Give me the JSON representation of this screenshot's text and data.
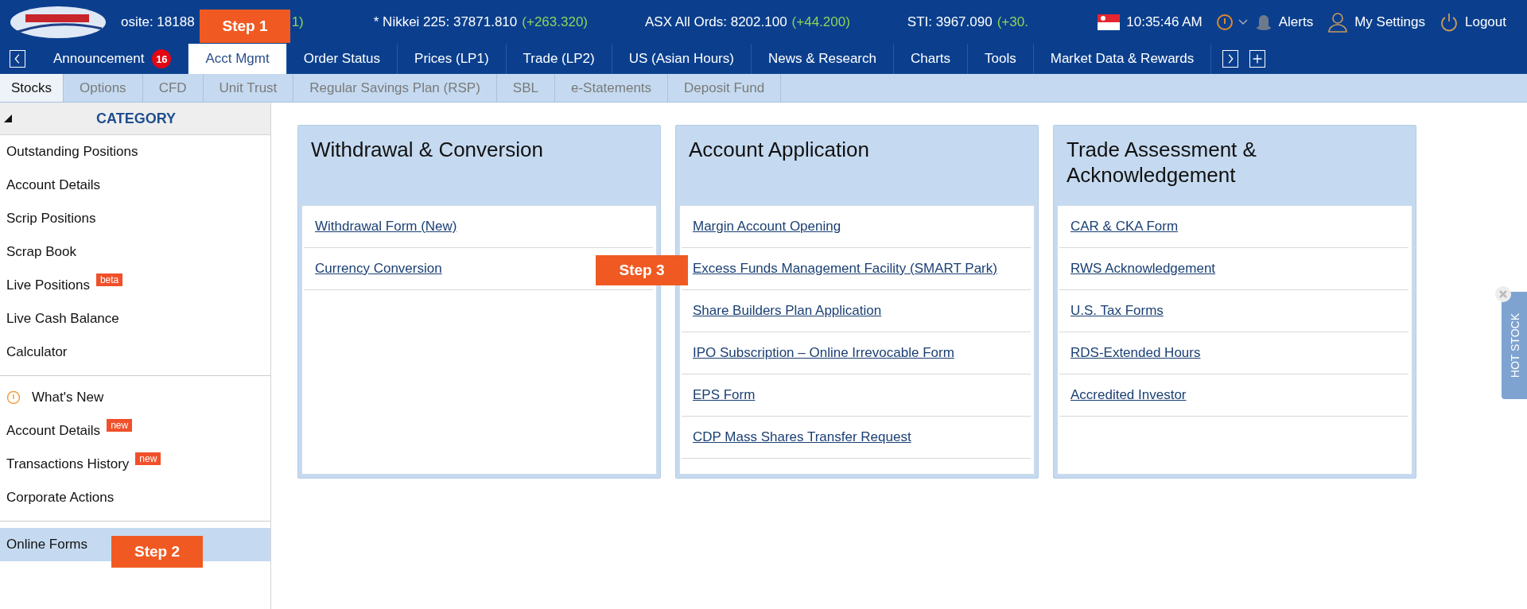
{
  "ticker": [
    {
      "text": "osite: 18188",
      "change": "1)"
    },
    {
      "text": "* Nikkei 225: 37871.810",
      "change": "(+263.320)"
    },
    {
      "text": "ASX All Ords: 8202.100",
      "change": "(+44.200)"
    },
    {
      "text": "STI: 3967.090",
      "change": "(+30."
    }
  ],
  "header": {
    "time": "10:35:46 AM",
    "alerts": "Alerts",
    "settings": "My Settings",
    "logout": "Logout"
  },
  "nav": [
    {
      "label": "Announcement",
      "badge": "16",
      "selected": false
    },
    {
      "label": "Acct Mgmt",
      "selected": true
    },
    {
      "label": "Order Status",
      "selected": false
    },
    {
      "label": "Prices (LP1)",
      "selected": false
    },
    {
      "label": "Trade (LP2)",
      "selected": false
    },
    {
      "label": "US (Asian Hours)",
      "selected": false
    },
    {
      "label": "News & Research",
      "selected": false
    },
    {
      "label": "Charts",
      "selected": false
    },
    {
      "label": "Tools",
      "selected": false
    },
    {
      "label": "Market Data & Rewards",
      "selected": false
    }
  ],
  "subtabs": [
    {
      "label": "Stocks",
      "selected": true
    },
    {
      "label": "Options",
      "selected": false
    },
    {
      "label": "CFD",
      "selected": false
    },
    {
      "label": "Unit Trust",
      "selected": false
    },
    {
      "label": "Regular Savings Plan (RSP)",
      "selected": false
    },
    {
      "label": "SBL",
      "selected": false
    },
    {
      "label": "e-Statements",
      "selected": false
    },
    {
      "label": "Deposit Fund",
      "selected": false
    }
  ],
  "sidebar": {
    "title": "CATEGORY",
    "groups": [
      [
        {
          "label": "Outstanding Positions",
          "selected": false
        },
        {
          "label": "Account Details",
          "selected": false
        },
        {
          "label": "Scrip Positions",
          "selected": false
        },
        {
          "label": "Scrap Book",
          "selected": false
        },
        {
          "label": "Live Positions",
          "badge": "beta",
          "selected": false
        },
        {
          "label": "Live Cash Balance",
          "selected": false
        },
        {
          "label": "Calculator",
          "selected": false
        }
      ],
      [
        {
          "label": "What's New",
          "kind": "info",
          "selected": false
        },
        {
          "label": "Account Details",
          "badge": "new",
          "selected": false
        },
        {
          "label": "Transactions History",
          "badge": "new",
          "selected": false
        },
        {
          "label": "Corporate Actions",
          "selected": false
        }
      ],
      [
        {
          "label": "Online Forms",
          "selected": true
        }
      ]
    ]
  },
  "cards": [
    {
      "title": "Withdrawal & Conversion",
      "links": [
        "Withdrawal Form (New)",
        "Currency Conversion"
      ]
    },
    {
      "title": "Account Application",
      "links": [
        "Margin Account Opening",
        "Excess Funds Management Facility (SMART Park)",
        "Share Builders Plan Application",
        "IPO Subscription – Online Irrevocable Form",
        "EPS Form",
        "CDP Mass Shares Transfer Request"
      ]
    },
    {
      "title": "Trade Assessment & Acknowledgement",
      "links": [
        "CAR & CKA Form",
        "RWS Acknowledgement",
        "U.S. Tax Forms",
        "RDS-Extended Hours",
        "Accredited Investor"
      ]
    }
  ],
  "steps": [
    "Step 1",
    "Step 2",
    "Step 3"
  ],
  "hot_stock": "HOT STOCK"
}
